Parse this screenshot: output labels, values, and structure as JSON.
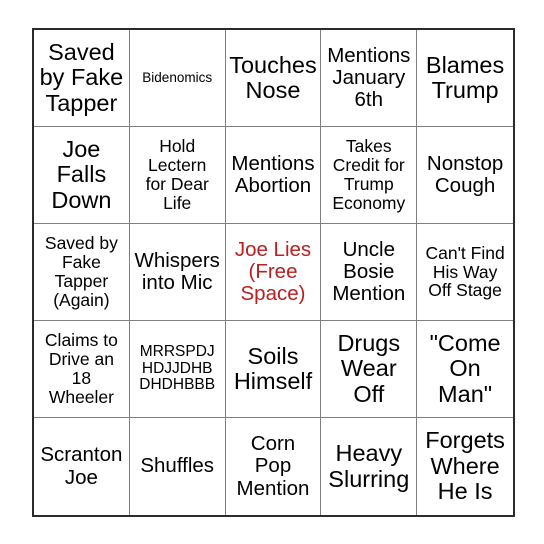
{
  "card": {
    "free_space_color": "#b92020",
    "text_color": "#000000",
    "grid_line_color": "#808080",
    "border_color": "#2b2b2b",
    "rows": [
      [
        {
          "text": "Saved\nby Fake\nTapper",
          "size": "xl",
          "free": false
        },
        {
          "text": "Bidenomics",
          "size": "xs",
          "free": false
        },
        {
          "text": "Touches\nNose",
          "size": "xl",
          "free": false
        },
        {
          "text": "Mentions\nJanuary\n6th",
          "size": "lg",
          "free": false
        },
        {
          "text": "Blames\nTrump",
          "size": "xl",
          "free": false
        }
      ],
      [
        {
          "text": "Joe\nFalls\nDown",
          "size": "xl",
          "free": false
        },
        {
          "text": "Hold\nLectern\nfor Dear\nLife",
          "size": "md",
          "free": false
        },
        {
          "text": "Mentions\nAbortion",
          "size": "lg",
          "free": false
        },
        {
          "text": "Takes\nCredit for\nTrump\nEconomy",
          "size": "md",
          "free": false
        },
        {
          "text": "Nonstop\nCough",
          "size": "lg",
          "free": false
        }
      ],
      [
        {
          "text": "Saved by\nFake\nTapper\n(Again)",
          "size": "md",
          "free": false
        },
        {
          "text": "Whispers\ninto Mic",
          "size": "lg",
          "free": false
        },
        {
          "text": "Joe Lies\n(Free\nSpace)",
          "size": "lg",
          "free": true
        },
        {
          "text": "Uncle\nBosie\nMention",
          "size": "lg",
          "free": false
        },
        {
          "text": "Can't Find\nHis Way\nOff Stage",
          "size": "md",
          "free": false
        }
      ],
      [
        {
          "text": "Claims to\nDrive an\n18\nWheeler",
          "size": "md",
          "free": false
        },
        {
          "text": "MRRSPDJ\nHDJJDHB\nDHDHBBB",
          "size": "sm",
          "free": false
        },
        {
          "text": "Soils\nHimself",
          "size": "xl",
          "free": false
        },
        {
          "text": "Drugs\nWear\nOff",
          "size": "xl",
          "free": false
        },
        {
          "text": "\"Come\nOn\nMan\"",
          "size": "xl",
          "free": false
        }
      ],
      [
        {
          "text": "Scranton\nJoe",
          "size": "lg",
          "free": false
        },
        {
          "text": "Shuffles",
          "size": "lg",
          "free": false
        },
        {
          "text": "Corn\nPop\nMention",
          "size": "lg",
          "free": false
        },
        {
          "text": "Heavy\nSlurring",
          "size": "xl",
          "free": false
        },
        {
          "text": "Forgets\nWhere\nHe Is",
          "size": "xl",
          "free": false
        }
      ]
    ]
  }
}
